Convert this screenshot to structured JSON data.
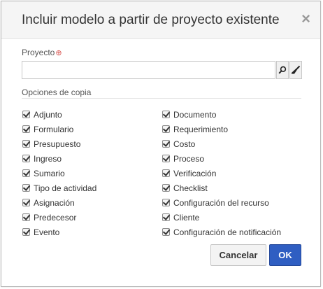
{
  "dialog": {
    "title": "Incluir modelo a partir de proyecto existente",
    "close_label": "×"
  },
  "project": {
    "label": "Proyecto",
    "required_marker": "⊕",
    "value": ""
  },
  "copy_options": {
    "heading": "Opciones de copia",
    "left": [
      {
        "label": "Adjunto",
        "checked": true
      },
      {
        "label": "Formulario",
        "checked": true
      },
      {
        "label": "Presupuesto",
        "checked": true
      },
      {
        "label": "Ingreso",
        "checked": true
      },
      {
        "label": "Sumario",
        "checked": true
      },
      {
        "label": "Tipo de actividad",
        "checked": true
      },
      {
        "label": "Asignación",
        "checked": true
      },
      {
        "label": "Predecesor",
        "checked": true
      },
      {
        "label": "Evento",
        "checked": true
      }
    ],
    "right": [
      {
        "label": "Documento",
        "checked": true
      },
      {
        "label": "Requerimiento",
        "checked": true
      },
      {
        "label": "Costo",
        "checked": true
      },
      {
        "label": "Proceso",
        "checked": true
      },
      {
        "label": "Verificación",
        "checked": true
      },
      {
        "label": "Checklist",
        "checked": true
      },
      {
        "label": "Configuración del recurso",
        "checked": true
      },
      {
        "label": "Cliente",
        "checked": true
      },
      {
        "label": "Configuración de notificación",
        "checked": true
      }
    ]
  },
  "buttons": {
    "cancel": "Cancelar",
    "ok": "OK"
  },
  "icons": {
    "search": "search-icon",
    "clear": "eraser-icon",
    "close": "close-icon"
  },
  "colors": {
    "ok_button": "#2f5ec2",
    "required": "#d9534f"
  }
}
